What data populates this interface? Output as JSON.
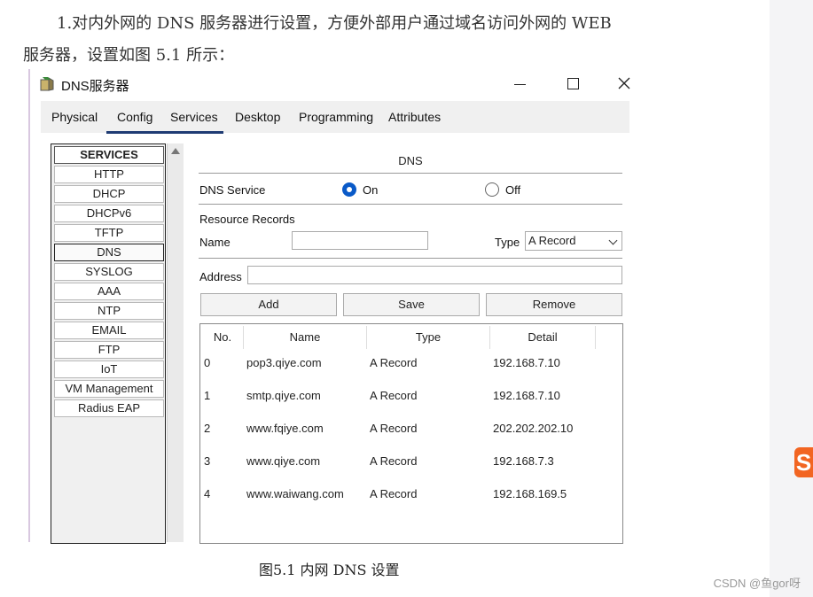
{
  "document": {
    "line1": "1.对内外网的 DNS 服务器进行设置，方便外部用户通过域名访问外网的 WEB",
    "line2": "服务器，设置如图 5.1 所示：",
    "caption": "图5.1  内网 DNS 设置",
    "watermark": "CSDN @鱼gor呀",
    "side_logo": "S"
  },
  "window": {
    "title": "DNS服务器",
    "tabs": [
      "Physical",
      "Config",
      "Services",
      "Desktop",
      "Programming",
      "Attributes"
    ],
    "active_tab": "Services"
  },
  "services": {
    "header": "SERVICES",
    "items": [
      "HTTP",
      "DHCP",
      "DHCPv6",
      "TFTP",
      "DNS",
      "SYSLOG",
      "AAA",
      "NTP",
      "EMAIL",
      "FTP",
      "IoT",
      "VM Management",
      "Radius EAP"
    ],
    "selected": "DNS"
  },
  "dns": {
    "section_title": "DNS",
    "service_label": "DNS Service",
    "on_label": "On",
    "off_label": "Off",
    "service_state": "On",
    "resource_records_label": "Resource Records",
    "name_label": "Name",
    "name_value": "",
    "type_label": "Type",
    "type_value": "A Record",
    "address_label": "Address",
    "address_value": "",
    "add_label": "Add",
    "save_label": "Save",
    "remove_label": "Remove",
    "columns": [
      "No.",
      "Name",
      "Type",
      "Detail"
    ],
    "records": [
      {
        "no": "0",
        "name": "pop3.qiye.com",
        "type": "A Record",
        "detail": "192.168.7.10"
      },
      {
        "no": "1",
        "name": "smtp.qiye.com",
        "type": "A Record",
        "detail": "192.168.7.10"
      },
      {
        "no": "2",
        "name": "www.fqiye.com",
        "type": "A Record",
        "detail": "202.202.202.10"
      },
      {
        "no": "3",
        "name": "www.qiye.com",
        "type": "A Record",
        "detail": "192.168.7.3"
      },
      {
        "no": "4",
        "name": "www.waiwang.com",
        "type": "A Record",
        "detail": "192.168.169.5"
      }
    ]
  }
}
